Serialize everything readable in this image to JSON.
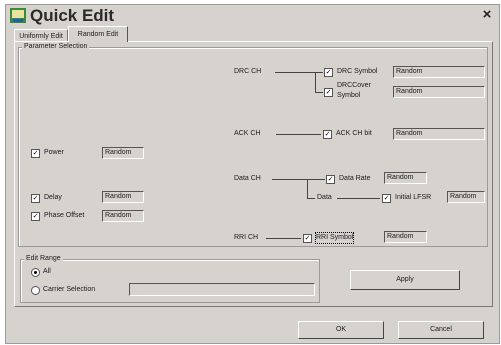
{
  "window": {
    "title": "Quick Edit",
    "close_glyph": "×",
    "icon": "app-icon"
  },
  "tabs": [
    {
      "label": "Uniformly Edit",
      "selected": false
    },
    {
      "label": "Random Edit",
      "selected": true
    }
  ],
  "parameter_selection": {
    "legend": "Parameter Selection",
    "left": [
      {
        "label": "Power",
        "checked": true,
        "value": "Random"
      },
      {
        "label": "Delay",
        "checked": true,
        "value": "Random"
      },
      {
        "label": "Phase Offset",
        "checked": true,
        "value": "Random"
      }
    ],
    "drc": {
      "channel": "DRC CH",
      "items": [
        {
          "label": "DRC Symbol",
          "checked": true,
          "value": "Random"
        },
        {
          "label_line1": "DRCCover",
          "label_line2": "Symbol",
          "checked": true,
          "value": "Random"
        }
      ]
    },
    "ack": {
      "channel": "ACK CH",
      "item": {
        "label": "ACK CH bit",
        "checked": true,
        "value": "Random"
      }
    },
    "data": {
      "channel": "Data CH",
      "rate": {
        "label": "Data Rate",
        "checked": true,
        "value": "Random"
      },
      "sub_label": "Data",
      "lfsr": {
        "label": "Initial LFSR",
        "checked": true,
        "value": "Random"
      }
    },
    "rri": {
      "channel": "RRI CH",
      "item": {
        "label": "RRI Symbol",
        "checked": true,
        "value": "Random"
      }
    }
  },
  "edit_range": {
    "legend": "Edit Range",
    "options": [
      {
        "label": "All",
        "selected": true
      },
      {
        "label": "Carrier Selection",
        "selected": false
      }
    ],
    "carrier_value": ""
  },
  "buttons": {
    "apply": "Apply",
    "ok": "OK",
    "cancel": "Cancel"
  },
  "check_glyph": "✓"
}
